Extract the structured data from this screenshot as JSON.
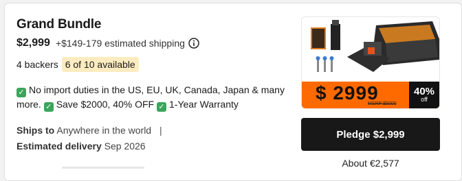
{
  "offer": {
    "title": "Grand Bundle",
    "price": "$2,999",
    "shipping": "+$149-179 estimated shipping",
    "backers": "4 backers",
    "availability": "6 of 10 available",
    "perks": [
      "No import duties in the US, EU, UK, Canada, Japan & many more.",
      "Save $2000, 40% OFF",
      "1-Year Warranty"
    ],
    "ships_to_label": "Ships to",
    "ships_to_value": "Anywhere in the world",
    "separator": "|",
    "delivery_label": "Estimated delivery",
    "delivery_value": "Sep 2026"
  },
  "image": {
    "banner_price": "$ 2999",
    "msrp": "MSRP $5000",
    "off_pct": "40%",
    "off_label": "off"
  },
  "actions": {
    "pledge_label": "Pledge $2,999",
    "about_price": "About €2,577"
  },
  "colors": {
    "check": "#3ba55c",
    "availability_bg": "#fdecc0",
    "banner": "#ff6a00",
    "pledge_bg": "#181818"
  }
}
